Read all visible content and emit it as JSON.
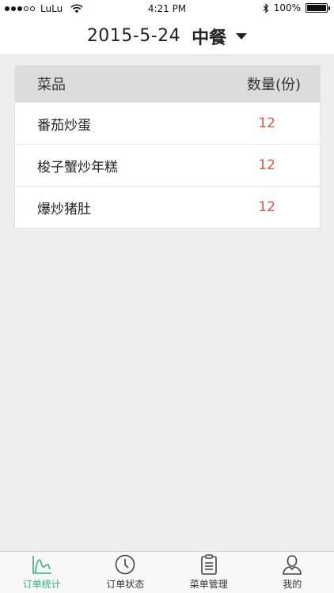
{
  "status_bar": {
    "carrier": "LuLu",
    "time": "4:21 PM",
    "battery": "100%",
    "battery_level": 1.0
  },
  "header": {
    "date": "2015-5-24",
    "meal": "中餐",
    "dropdown_icon": "caret-down-icon"
  },
  "table": {
    "col_dish": "菜品",
    "col_qty": "数量(份)",
    "rows": [
      {
        "dish": "番茄炒蛋",
        "qty": "12"
      },
      {
        "dish": "梭子蟹炒年糕",
        "qty": "12"
      },
      {
        "dish": "爆炒猪肚",
        "qty": "12"
      }
    ]
  },
  "tabs": [
    {
      "label": "订单统计",
      "icon": "chart-icon",
      "active": true
    },
    {
      "label": "订单状态",
      "icon": "clock-icon",
      "active": false
    },
    {
      "label": "菜单管理",
      "icon": "clipboard-icon",
      "active": false
    },
    {
      "label": "我的",
      "icon": "user-icon",
      "active": false
    }
  ],
  "colors": {
    "accent_green": "#2fb184",
    "qty_red": "#e5533f",
    "header_gray": "#dcdcdc",
    "background": "#eeeeee"
  }
}
